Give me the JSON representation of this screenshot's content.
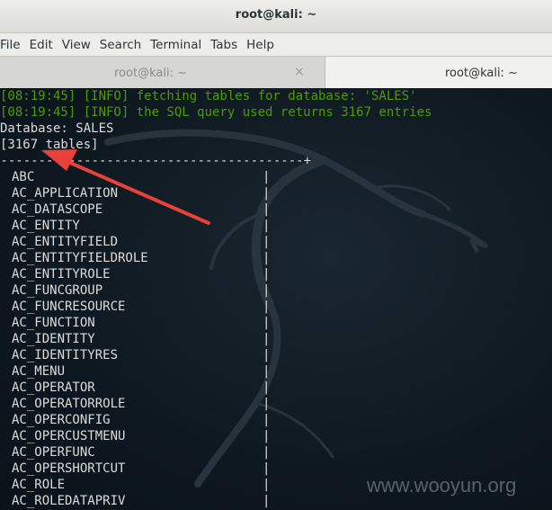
{
  "window": {
    "title": "root@kali: ~"
  },
  "menubar": {
    "items": [
      "File",
      "Edit",
      "View",
      "Search",
      "Terminal",
      "Tabs",
      "Help"
    ]
  },
  "tabs": [
    {
      "label": "root@kali: ~",
      "active": false,
      "close_glyph": "×"
    },
    {
      "label": "root@kali: ~",
      "active": true
    }
  ],
  "terminal": {
    "log": [
      "[08:19:45] [INFO] fetching tables for database: 'SALES'",
      "[08:19:45] [INFO] the SQL query used returns 3167 entries"
    ],
    "database_line": "Database: SALES",
    "count_line": "[3167 tables]",
    "table_border": "+----------------------------------------+",
    "tables": [
      "ABC",
      "AC_APPLICATION",
      "AC_DATASCOPE",
      "AC_ENTITY",
      "AC_ENTITYFIELD",
      "AC_ENTITYFIELDROLE",
      "AC_ENTITYROLE",
      "AC_FUNCGROUP",
      "AC_FUNCRESOURCE",
      "AC_FUNCTION",
      "AC_IDENTITY",
      "AC_IDENTITYRES",
      "AC_MENU",
      "AC_OPERATOR",
      "AC_OPERATORROLE",
      "AC_OPERCONFIG",
      "AC_OPERCUSTMENU",
      "AC_OPERFUNC",
      "AC_OPERSHORTCUT",
      "AC_ROLE",
      "AC_ROLEDATAPRIV"
    ]
  },
  "watermark": "www.wooyun.org",
  "colors": {
    "log_green": "#4e9a06",
    "text": "#dcdcdc",
    "arrow": "#e8403a",
    "background": "#0c1520"
  },
  "icons": {
    "dragon": "kali-dragon-logo",
    "arrow": "red-annotation-arrow"
  }
}
